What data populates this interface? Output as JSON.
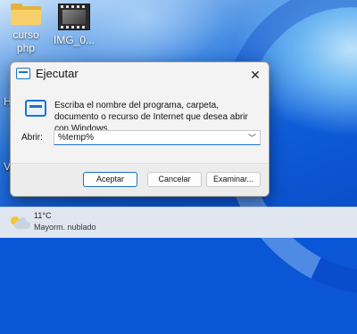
{
  "desktop": {
    "icons": [
      {
        "label_line1": "curso",
        "label_line2": "php",
        "type": "folder"
      },
      {
        "label_line1": "IMG_0...",
        "type": "video"
      }
    ],
    "edge_letters": [
      "H",
      "V"
    ]
  },
  "run_dialog": {
    "title": "Ejecutar",
    "close_glyph": "✕",
    "description": "Escriba el nombre del programa, carpeta, documento o recurso de Internet que desea abrir con Windows.",
    "open_label": "Abrir:",
    "open_value": "%temp%",
    "dropdown_glyph": "﹀",
    "buttons": {
      "ok": "Aceptar",
      "cancel": "Cancelar",
      "browse": "Examinar..."
    }
  },
  "taskbar": {
    "weather": {
      "temperature": "11°C",
      "condition": "Mayorm. nublado",
      "icon": "partly-cloudy-icon"
    }
  },
  "colors": {
    "accent": "#1a73c8",
    "wallpaper": "#0a56d6"
  }
}
